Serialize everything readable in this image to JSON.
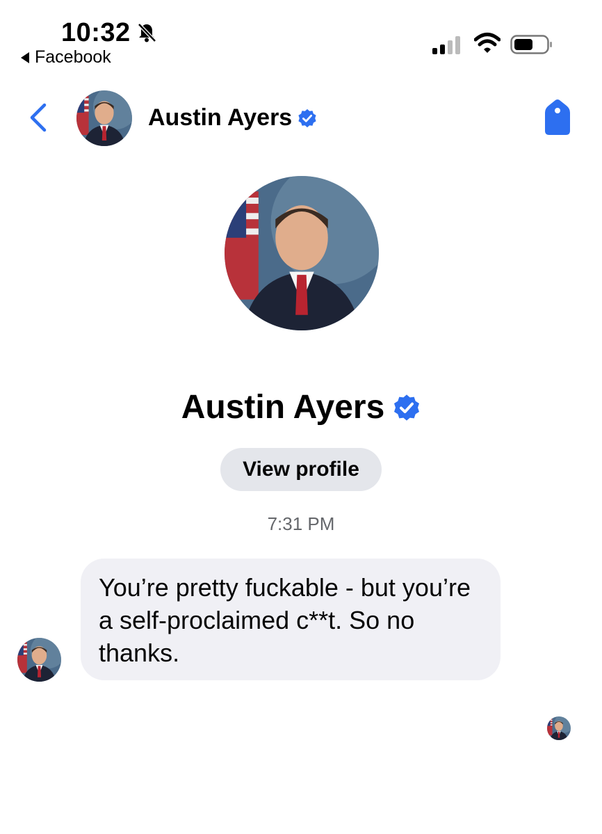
{
  "status_bar": {
    "time": "10:32",
    "back_app_label": "Facebook",
    "icons": [
      "bell-muted-icon",
      "signal-icon",
      "wifi-icon",
      "battery-icon"
    ]
  },
  "header": {
    "name": "Austin Ayers",
    "icons": [
      "back-chevron-icon",
      "verified-badge-icon",
      "tag-icon"
    ]
  },
  "profile": {
    "name": "Austin Ayers",
    "view_profile_label": "View profile"
  },
  "conversation": {
    "timestamp": "7:31 PM",
    "messages": [
      {
        "sender": "Austin Ayers",
        "text": "You’re pretty fuckable - but you’re a self-proclaimed c**t. So no thanks."
      }
    ]
  },
  "colors": {
    "accent": "#2d6ff0",
    "bubble": "#f0f0f5",
    "pill": "#e4e6eb",
    "muted_text": "#65676b"
  }
}
